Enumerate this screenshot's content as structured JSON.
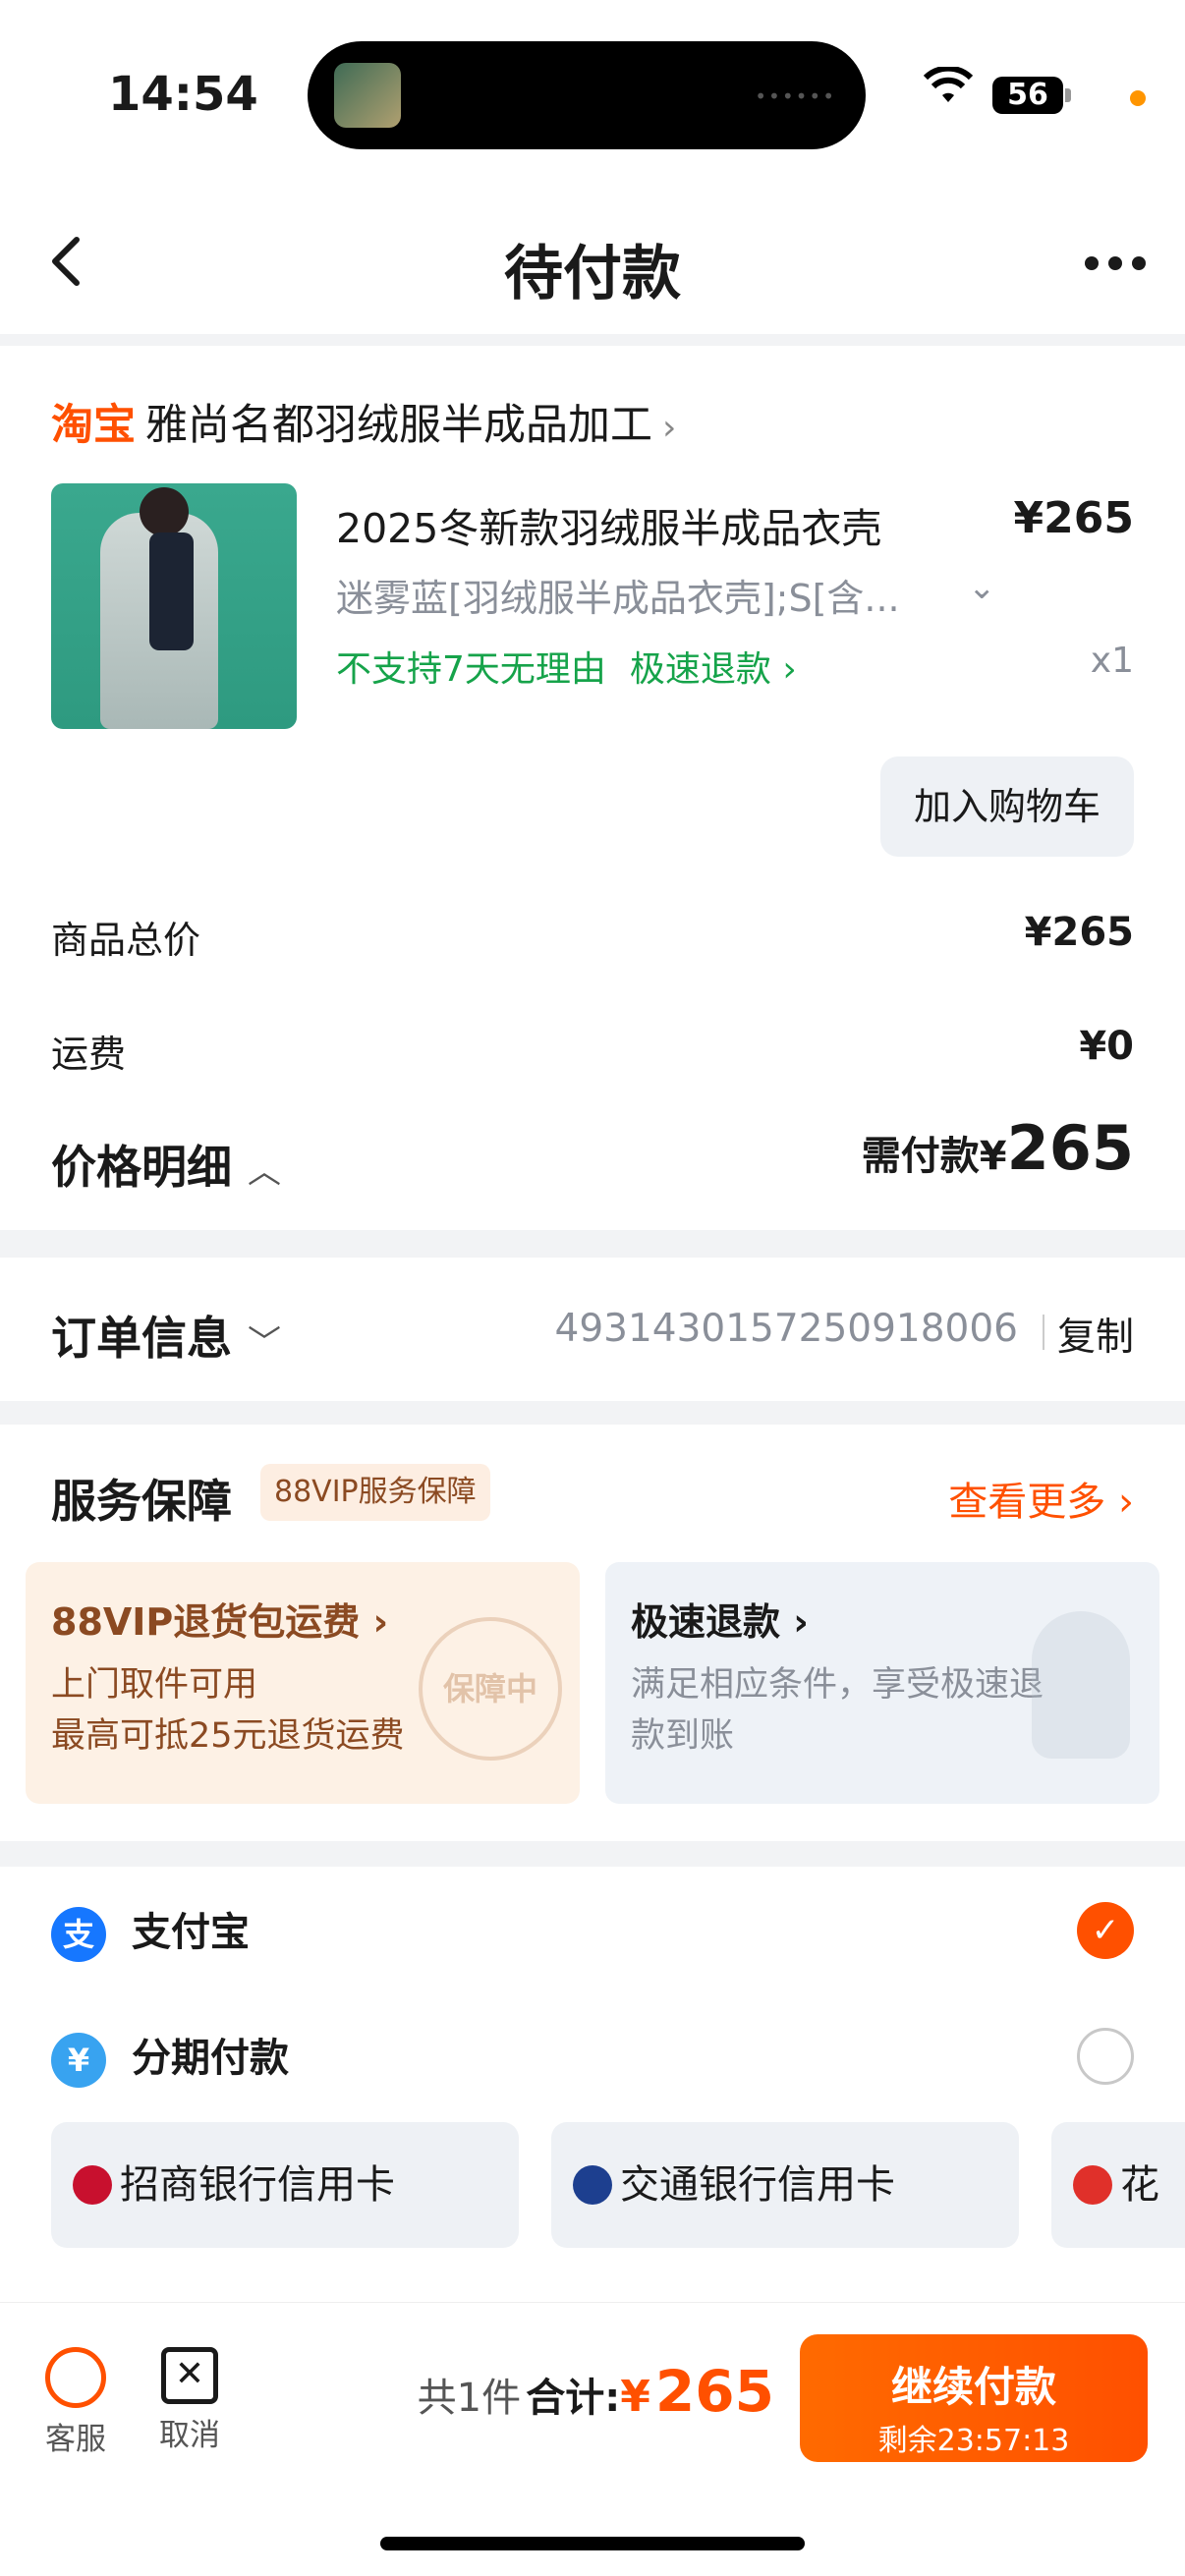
{
  "status_bar": {
    "time": "14:54",
    "battery": "56"
  },
  "nav": {
    "title": "待付款"
  },
  "shop": {
    "logo": "淘宝",
    "name": "雅尚名都羽绒服半成品加工",
    "arrow": "›"
  },
  "product": {
    "title": "2025冬新款羽绒服半成品衣壳",
    "price": "¥265",
    "spec": "迷雾蓝[羽绒服半成品衣壳];S[含...",
    "tag_no_return": "不支持7天无理由",
    "tag_fast_refund": "极速退款 ›",
    "qty": "x1",
    "cart_button": "加入购物车"
  },
  "price": {
    "goods_total_label": "商品总价",
    "goods_total_value": "¥265",
    "shipping_label": "运费",
    "shipping_value": "¥0",
    "detail_label": "价格明细",
    "need_pay_label": "需付款¥",
    "need_pay_value": "265"
  },
  "order_info": {
    "label": "订单信息",
    "number": "4931430157250918006",
    "copy": "复制"
  },
  "service": {
    "label": "服务保障",
    "badge": "88VIP服务保障",
    "more": "查看更多 ›",
    "box1_title": "88VIP退货包运费 ›",
    "box1_line1": "上门取件可用",
    "box1_line2": "最高可抵25元退货运费",
    "box1_stamp": "保障中",
    "box2_title": "极速退款 ›",
    "box2_desc": "满足相应条件，享受极速退款到账"
  },
  "payment": {
    "alipay": "支付宝",
    "alipay_icon": "支",
    "installment": "分期付款",
    "installment_icon": "¥",
    "banks": [
      "招商银行信用卡",
      "交通银行信用卡",
      "花"
    ]
  },
  "bottom": {
    "service_label": "客服",
    "cancel_label": "取消",
    "count": "共1件",
    "total_label": "合计:",
    "yen": "¥",
    "total_value": "265",
    "pay_button": "继续付款",
    "remaining": "剩余23:57:13"
  },
  "colors": {
    "accent": "#ff5000",
    "green": "#16a34a",
    "alipay": "#1677ff"
  }
}
